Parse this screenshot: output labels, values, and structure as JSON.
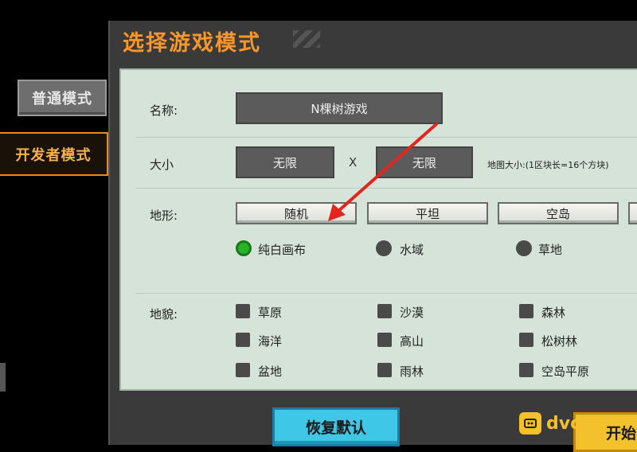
{
  "sidebar": {
    "normal_mode": "普通模式",
    "developer_mode": "开发者模式"
  },
  "dialog": {
    "title": "选择游戏模式"
  },
  "form": {
    "name_label": "名称:",
    "name_value": "N棵树游戏",
    "size_label": "大小",
    "width_value": "无限",
    "size_separator": "X",
    "height_value": "无限",
    "map_size_note": "地图大小:(1区块长=16个方块)",
    "terrain_label": "地形:",
    "terrain_buttons": [
      "随机",
      "平坦",
      "空岛"
    ],
    "terrain_radios": [
      {
        "label": "纯白画布",
        "selected": true
      },
      {
        "label": "水域",
        "selected": false
      },
      {
        "label": "草地",
        "selected": false
      }
    ],
    "biome_label": "地貌:",
    "biomes": [
      "草原",
      "沙漠",
      "森林",
      "海洋",
      "高山",
      "松树林",
      "盆地",
      "雨林",
      "空岛平原"
    ]
  },
  "footer": {
    "restore_label": "恢复默认",
    "start_label": "开始"
  },
  "watermark": {
    "text": "dvc"
  },
  "colors": {
    "accent_orange": "#f7962a",
    "panel_bg": "#d5e3d9",
    "radio_selected": "#27b327",
    "restore_button": "#3fc7e8",
    "start_button": "#f3c12c"
  }
}
